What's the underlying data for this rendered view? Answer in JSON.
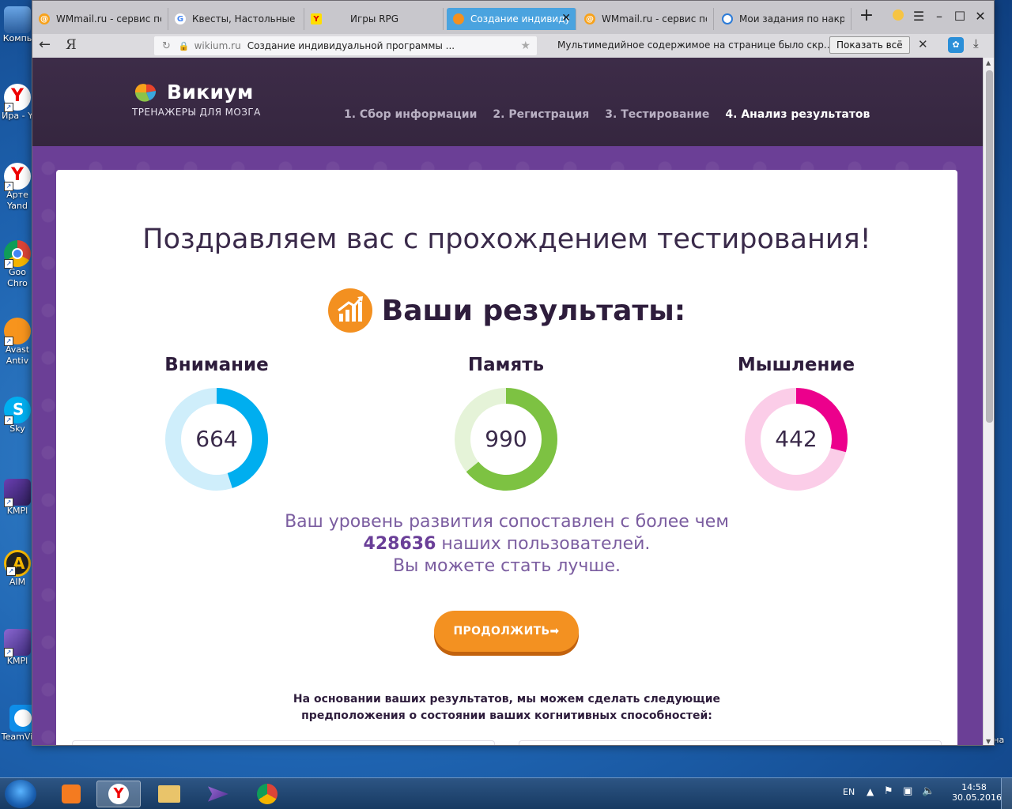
{
  "desktop": {
    "left_icons": [
      {
        "name": "computer",
        "label": "Компь"
      },
      {
        "name": "yandex-ira",
        "label": "Ира - Y"
      },
      {
        "name": "yandex-artem",
        "label": "Арте"
      },
      {
        "name": "yandex-artem-2",
        "label": "Yand"
      },
      {
        "name": "google-chrome",
        "label": "Goo"
      },
      {
        "name": "google-chrome-2",
        "label": "Chro"
      },
      {
        "name": "avast",
        "label": "Avast"
      },
      {
        "name": "avast-2",
        "label": "Antiv"
      },
      {
        "name": "skype",
        "label": "Sky"
      },
      {
        "name": "kmplayer",
        "label": "KMPl"
      },
      {
        "name": "aimp",
        "label": "AIM"
      },
      {
        "name": "kmplayer-2",
        "label": "KMPl"
      },
      {
        "name": "teamviewer",
        "label": "TeamViewer"
      }
    ],
    "right_icons": [
      {
        "label": "Корзина"
      }
    ]
  },
  "browser": {
    "tabs": [
      {
        "title": "WMmail.ru - сервис поч",
        "icon": "wmmail-icon"
      },
      {
        "title": "Квесты, Настольные игр",
        "icon": "google-icon"
      },
      {
        "title": "Игры RPG",
        "icon": "yandex-icon"
      },
      {
        "title": "Создание индивиду",
        "icon": "wikium-icon",
        "active": true
      },
      {
        "title": "WMmail.ru - сервис поч",
        "icon": "wmmail-icon"
      },
      {
        "title": "Мои задания по накрут",
        "icon": "target-icon"
      }
    ],
    "new_tab": "+",
    "address": {
      "back": "←",
      "yandex": "Я",
      "host": "wikium.ru",
      "page_title": "Создание индивидуальной программы ...",
      "notice": "Мультимедийное содержимое на странице было скр...",
      "show_all": "Показать всё"
    }
  },
  "site": {
    "brand": "Викиум",
    "tagline": "ТРЕНАЖЕРЫ ДЛЯ МОЗГА",
    "steps": [
      {
        "label": "1. Сбор информации"
      },
      {
        "label": "2. Регистрация"
      },
      {
        "label": "3. Тестирование"
      },
      {
        "label": "4. Анализ результатов",
        "current": true
      }
    ],
    "congrats": "Поздравляем вас с прохождением тестирования!",
    "results_title": "Ваши результаты:",
    "metrics": [
      {
        "label": "Внимание",
        "value": "664",
        "fraction": 0.45,
        "color": "#00aeef",
        "track": "#cfeefb"
      },
      {
        "label": "Память",
        "value": "990",
        "fraction": 0.64,
        "color": "#7dc242",
        "track": "#e5f3d8"
      },
      {
        "label": "Мышление",
        "value": "442",
        "fraction": 0.29,
        "color": "#ec008c",
        "track": "#fbcde8"
      }
    ],
    "compare": {
      "line1": "Ваш уровень развития сопоставлен с более чем",
      "count": "428636",
      "line2_rest": "наших пользователей.",
      "line3": "Вы можете стать лучше."
    },
    "continue_label": "ПРОДОЛЖИТЬ➡",
    "assumption_line1": "На основании ваших результатов, мы можем сделать следующие",
    "assumption_line2": "предположения о состоянии ваших когнитивных способностей:"
  },
  "taskbar": {
    "lang": "EN",
    "time": "14:58",
    "date": "30.05.2016"
  }
}
